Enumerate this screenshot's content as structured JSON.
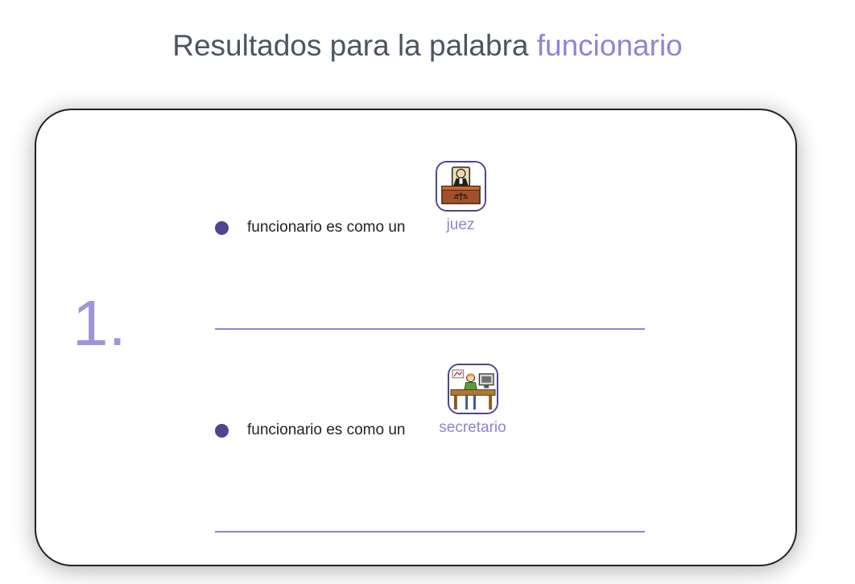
{
  "header": {
    "title_prefix": "Resultados para la palabra",
    "search_word": "funcionario"
  },
  "result": {
    "number": "1.",
    "items": [
      {
        "sentence": "funcionario es como un",
        "related_word": "juez",
        "icon": "judge-icon"
      },
      {
        "sentence": "funcionario es como un",
        "related_word": "secretario",
        "icon": "secretary-icon"
      }
    ]
  },
  "colors": {
    "accent": "#8f84d3",
    "bullet": "#4e4590",
    "title_text": "#4b5563"
  }
}
